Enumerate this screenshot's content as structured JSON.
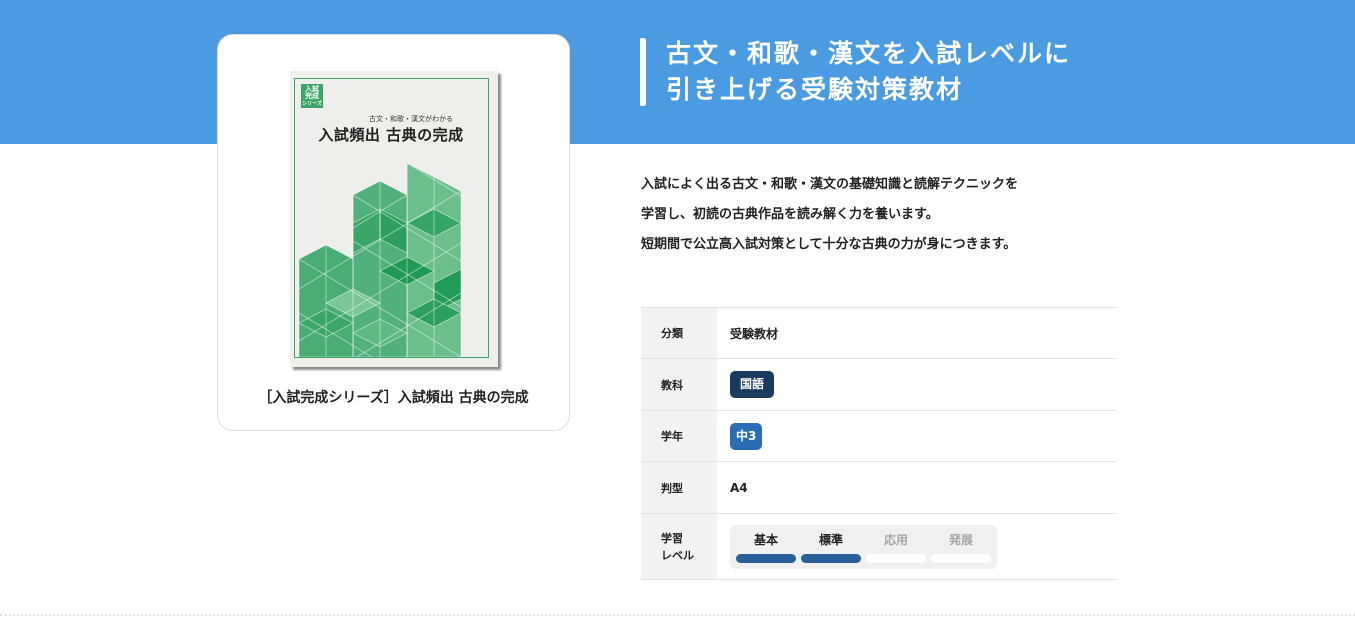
{
  "book": {
    "badge": "入試\n完成\nシリーズ",
    "cover_subtitle": "古文・和歌・漢文がわかる",
    "cover_title": "入試頻出 古典の完成",
    "caption": "［入試完成シリーズ］入試頻出 古典の完成"
  },
  "headline": {
    "line1": "古文・和歌・漢文を入試レベルに",
    "line2": "引き上げる受験対策教材"
  },
  "description": [
    "入試によく出る古文・和歌・漢文の基礎知識と読解テクニックを",
    "学習し、初読の古典作品を読み解く力を養います。",
    "短期間で公立高入試対策として十分な古典の力が身につきます。"
  ],
  "specs": {
    "category": {
      "label": "分類",
      "value": "受験教材"
    },
    "subject": {
      "label": "教科",
      "value": "国語"
    },
    "grade": {
      "label": "学年",
      "value": "中3"
    },
    "size": {
      "label": "判型",
      "value": "A4"
    },
    "level": {
      "label_line1": "学習",
      "label_line2": "レベル",
      "levels": [
        {
          "name": "基本",
          "active": true
        },
        {
          "name": "標準",
          "active": true
        },
        {
          "name": "応用",
          "active": false
        },
        {
          "name": "発展",
          "active": false
        }
      ]
    }
  },
  "colors": {
    "banner": "#4b9be3",
    "subject_pill": "#1a3a5e",
    "grade_pill": "#2b6db4",
    "level_active": "#2a5f9a",
    "cover_green": "#3aa565"
  }
}
